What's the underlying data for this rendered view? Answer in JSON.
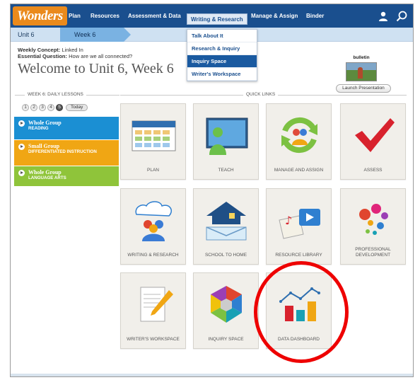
{
  "nav": {
    "logo": "Wonders",
    "items": [
      "Plan",
      "Resources",
      "Assessment & Data",
      "Writing & Research",
      "Manage & Assign",
      "Binder"
    ],
    "active_item": "Writing & Research",
    "icons": [
      "user-icon",
      "search-icon"
    ]
  },
  "dropdown": {
    "items": [
      "Talk About It",
      "Research & Inquiry",
      "Inquiry Space",
      "Writer's Workspace"
    ],
    "active_item": "Inquiry Space"
  },
  "breadcrumb": [
    "Unit 6",
    "Week 6"
  ],
  "concept": {
    "weekly_label": "Weekly Concept:",
    "weekly_value": " Linked In",
    "question_label": "Essential Question:",
    "question_value": " How are we all connected?"
  },
  "welcome": "Welcome to Unit 6, Week 6",
  "bulletin": {
    "label": "bulletin",
    "launch_button": "Launch Presentation"
  },
  "lessons_header": "WEEK 6: DAILY LESSONS",
  "days": [
    "1",
    "2",
    "3",
    "4",
    "5"
  ],
  "active_day": "5",
  "today_button": "Today",
  "lessons": [
    {
      "title": "Whole Group",
      "sub": "READING"
    },
    {
      "title": "Small Group",
      "sub": "DIFFERENTIATED INSTRUCTION"
    },
    {
      "title": "Whole Group",
      "sub": "LANGUAGE ARTS"
    }
  ],
  "quick_links_header": "QUICK LINKS",
  "tiles": [
    {
      "label": "PLAN",
      "icon": "plan-icon"
    },
    {
      "label": "TEACH",
      "icon": "teach-icon"
    },
    {
      "label": "MANAGE AND ASSIGN",
      "icon": "manage-assign-icon"
    },
    {
      "label": "ASSESS",
      "icon": "assess-checkmark-icon"
    },
    {
      "label": "WRITING & RESEARCH",
      "icon": "writing-research-icon"
    },
    {
      "label": "SCHOOL TO HOME",
      "icon": "school-to-home-icon"
    },
    {
      "label": "RESOURCE LIBRARY",
      "icon": "resource-library-icon"
    },
    {
      "label": "PROFESSIONAL DEVELOPMENT",
      "icon": "professional-development-icon"
    },
    {
      "label": "WRITER'S WORKSPACE",
      "icon": "writers-workspace-icon"
    },
    {
      "label": "INQUIRY SPACE",
      "icon": "inquiry-space-icon"
    },
    {
      "label": "DATA DASHBOARD",
      "icon": "data-dashboard-icon"
    }
  ],
  "colors": {
    "nav_bg": "#1a4f8e",
    "logo_bg": "#ea8a1c",
    "breadcrumb_bg": "#cfe1f2",
    "active_crumb": "#7ab2e2",
    "whole_group_reading": "#1b8fd3",
    "small_group": "#f0a614",
    "whole_group_language": "#8fc43a",
    "highlight_ring": "#e00000"
  }
}
